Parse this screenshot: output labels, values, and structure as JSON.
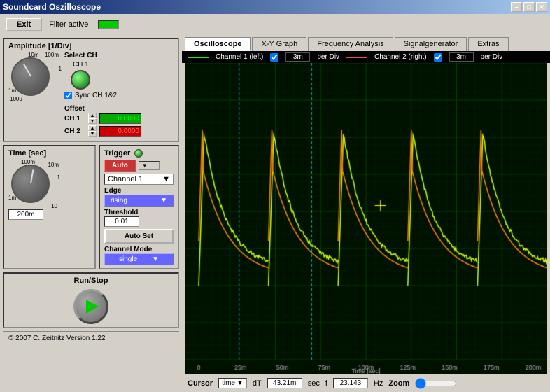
{
  "titlebar": {
    "title": "Soundcard Oszilloscope",
    "min_btn": "–",
    "max_btn": "□",
    "close_btn": "✕"
  },
  "topbar": {
    "exit_label": "Exit",
    "filter_label": "Filter active"
  },
  "tabs": [
    {
      "label": "Oscilloscope",
      "active": true
    },
    {
      "label": "X-Y Graph",
      "active": false
    },
    {
      "label": "Frequency Analysis",
      "active": false
    },
    {
      "label": "Signalgenerator",
      "active": false
    },
    {
      "label": "Extras",
      "active": false
    }
  ],
  "channels": {
    "ch1_label": "Channel 1 (left)",
    "ch1_per_div": "3m",
    "ch1_per_div_unit": "per Div",
    "ch2_label": "Channel 2 (right)",
    "ch2_per_div": "3m",
    "ch2_per_div_unit": "per Div"
  },
  "amplitude": {
    "title": "Amplitude [1/Div]",
    "labels_outer": [
      "10m",
      "100m",
      "1"
    ],
    "labels_inner": [
      "1m",
      "100u"
    ],
    "knob_value": "0.003",
    "select_ch": "Select CH",
    "ch1_label": "CH 1",
    "sync_label": "Sync CH 1&2",
    "offset_label": "Offset",
    "ch1_offset": "0.0000",
    "ch2_offset": "0.0000"
  },
  "time": {
    "title": "Time [sec]",
    "labels": [
      "100m",
      "10m",
      "1",
      "1m",
      "10"
    ],
    "value": "200m"
  },
  "trigger": {
    "title": "Trigger",
    "mode": "Auto",
    "channel": "Channel 1",
    "edge_label": "Edge",
    "edge_value": "rising",
    "threshold_label": "Threshold",
    "threshold_value": "0.01",
    "autoset_label": "Auto Set",
    "ch_mode_label": "Channel Mode",
    "ch_mode_value": "single"
  },
  "run_stop": {
    "label": "Run/Stop"
  },
  "cursor": {
    "label": "Cursor",
    "type": "time",
    "dt_label": "dT",
    "dt_value": "43.21m",
    "dt_unit": "sec",
    "f_label": "f",
    "f_value": "23.143",
    "f_unit": "Hz",
    "zoom_label": "Zoom"
  },
  "status": {
    "text": "© 2007  C. Zeitnitz Version 1.22"
  },
  "time_axis": {
    "labels": [
      "0",
      "25m",
      "50m",
      "75m",
      "100m",
      "125m",
      "150m",
      "175m",
      "200m"
    ],
    "title": "Time [sec]"
  }
}
